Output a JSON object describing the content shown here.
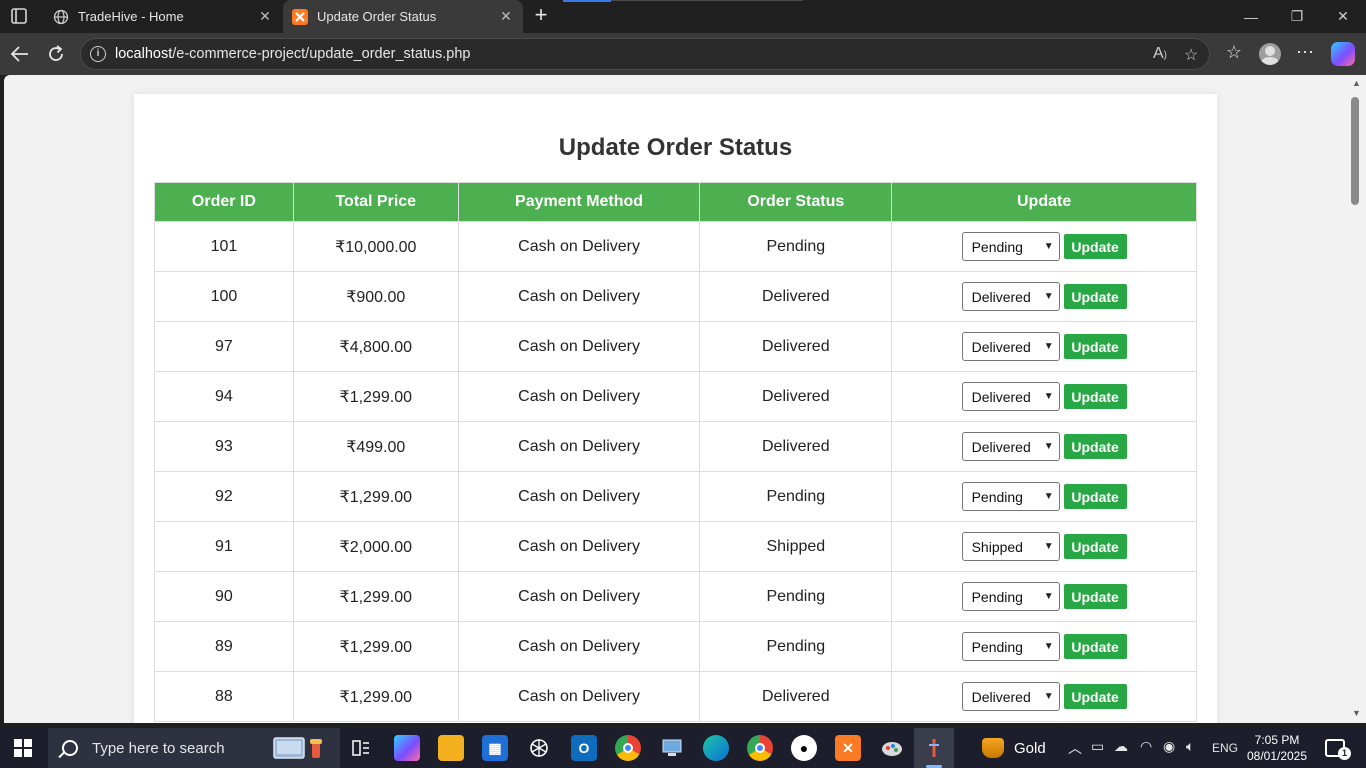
{
  "browser": {
    "tabs": [
      {
        "title": "TradeHive - Home",
        "close": "✕"
      },
      {
        "title": "Update Order Status",
        "close": "✕"
      }
    ],
    "new_tab": "+",
    "url_host": "localhost",
    "url_path": "/e-commerce-project/update_order_status.php",
    "accent_color": "#4caf50"
  },
  "page": {
    "title": "Update Order Status",
    "columns": [
      "Order ID",
      "Total Price",
      "Payment Method",
      "Order Status",
      "Update"
    ],
    "update_label": "Update",
    "rows": [
      {
        "id": "101",
        "price": "₹10,000.00",
        "method": "Cash on Delivery",
        "status": "Pending",
        "selected": "Pending"
      },
      {
        "id": "100",
        "price": "₹900.00",
        "method": "Cash on Delivery",
        "status": "Delivered",
        "selected": "Delivered"
      },
      {
        "id": "97",
        "price": "₹4,800.00",
        "method": "Cash on Delivery",
        "status": "Delivered",
        "selected": "Delivered"
      },
      {
        "id": "94",
        "price": "₹1,299.00",
        "method": "Cash on Delivery",
        "status": "Delivered",
        "selected": "Delivered"
      },
      {
        "id": "93",
        "price": "₹499.00",
        "method": "Cash on Delivery",
        "status": "Delivered",
        "selected": "Delivered"
      },
      {
        "id": "92",
        "price": "₹1,299.00",
        "method": "Cash on Delivery",
        "status": "Pending",
        "selected": "Pending"
      },
      {
        "id": "91",
        "price": "₹2,000.00",
        "method": "Cash on Delivery",
        "status": "Shipped",
        "selected": "Shipped"
      },
      {
        "id": "90",
        "price": "₹1,299.00",
        "method": "Cash on Delivery",
        "status": "Pending",
        "selected": "Pending"
      },
      {
        "id": "89",
        "price": "₹1,299.00",
        "method": "Cash on Delivery",
        "status": "Pending",
        "selected": "Pending"
      },
      {
        "id": "88",
        "price": "₹1,299.00",
        "method": "Cash on Delivery",
        "status": "Delivered",
        "selected": "Delivered"
      }
    ]
  },
  "taskbar": {
    "search_placeholder": "Type here to search",
    "weather_label": "Gold",
    "language": "ENG",
    "time": "7:05 PM",
    "date": "08/01/2025",
    "notification_count": "1"
  }
}
